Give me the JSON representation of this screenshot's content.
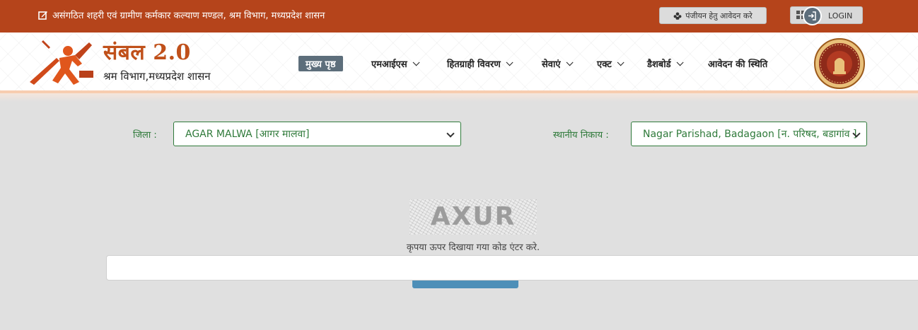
{
  "topbar": {
    "title": "असंगठित शहरी एवं ग्रामीण कर्मकार कल्याण मण्डल, श्रम विभाग, मध्यप्रदेश शासन",
    "register_label": "पंजीयन हेतु आवेदन करे",
    "login_label": "LOGIN"
  },
  "brand": {
    "title": "संबल 2.0",
    "subtitle": "श्रम विभाग,मध्यप्रदेश शासन"
  },
  "nav": {
    "items": [
      {
        "label": "मुख्य पृष्ठ"
      },
      {
        "label": "एमआईएस"
      },
      {
        "label": "हितग्राही विवरण"
      },
      {
        "label": "सेवाएं"
      },
      {
        "label": "एक्ट"
      },
      {
        "label": "डैशबोर्ड"
      },
      {
        "label": "आवेदन की स्थिति"
      }
    ]
  },
  "form": {
    "district_label": "जिला :",
    "district_value": "AGAR MALWA [आगर मालवा]",
    "local_body_label": "स्थानीय निकाय :",
    "local_body_value": "Nagar Parishad, Badagaon [न. परिषद, बडागांव ]",
    "captcha_text": "AXUR",
    "captcha_hint": "कृपया ऊपर दिखाया गया कोड एंटर करे.",
    "captcha_input_value": ""
  },
  "colors": {
    "topbar": "#b5441b",
    "nav_active": "#5d6e7b",
    "form_green": "#2f7a3a",
    "brand_orange": "#c0501a",
    "submit_blue": "#4e8fb8"
  }
}
